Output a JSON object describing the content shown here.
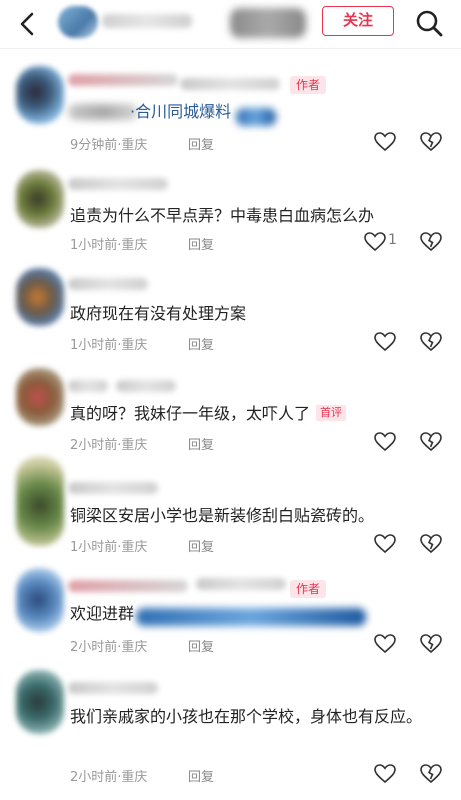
{
  "header": {
    "follow_label": "关注",
    "back_icon": "chevron-left-icon",
    "search_icon": "search-icon",
    "accent_color": "#e8344f"
  },
  "comments": [
    {
      "author_tag": "作者",
      "text": "·合川同城爆料",
      "time_location": "9分钟前·重庆",
      "reply": "回复",
      "likes": ""
    },
    {
      "text": "追责为什么不早点弄？中毒患白血病怎么办",
      "time_location": "1小时前·重庆",
      "reply": "回复",
      "likes": "1"
    },
    {
      "text": "政府现在有没有处理方案",
      "time_location": "1小时前·重庆",
      "reply": "回复",
      "likes": ""
    },
    {
      "text": "真的呀？我妹仔一年级，太吓人了",
      "first_tag": "首评",
      "time_location": "2小时前·重庆",
      "reply": "回复",
      "likes": ""
    },
    {
      "text": "铜梁区安居小学也是新装修刮白贴瓷砖的。",
      "time_location": "1小时前·重庆",
      "reply": "回复",
      "likes": ""
    },
    {
      "author_tag": "作者",
      "text": "欢迎进群",
      "time_location": "2小时前·重庆",
      "reply": "回复",
      "likes": ""
    },
    {
      "text": "我们亲戚家的小孩也在那个学校，身体也有反应。",
      "time_location": "2小时前·重庆",
      "reply": "回复",
      "likes": ""
    }
  ]
}
